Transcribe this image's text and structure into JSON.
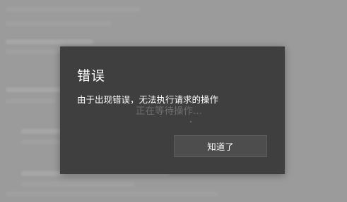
{
  "dialog": {
    "title": "错误",
    "message": "由于出现错误，无法执行请求的操作",
    "ok_label": "知道了"
  },
  "background": {
    "status_text": "正在等待操作..."
  }
}
